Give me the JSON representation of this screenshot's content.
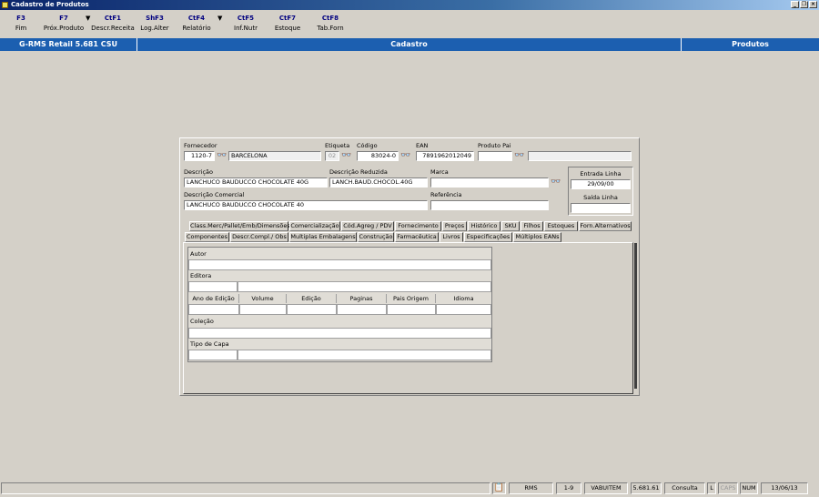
{
  "window": {
    "title": "Cadastro de Produtos",
    "buttons": {
      "minimize": "_",
      "restore": "❐",
      "close": "×"
    }
  },
  "toolbar": [
    {
      "key": "F3",
      "label": "Fim"
    },
    {
      "key": "F7",
      "label": "Próx.Produto"
    },
    {
      "key": "CtF1",
      "label": "Descr.Receita"
    },
    {
      "key": "ShF3",
      "label": "Log.Alter"
    },
    {
      "key": "CtF4",
      "label": "Relatório"
    },
    {
      "key": "CtF5",
      "label": "Inf.Nutr"
    },
    {
      "key": "CtF7",
      "label": "Estoque"
    },
    {
      "key": "CtF8",
      "label": "Tab.Forn"
    }
  ],
  "header": {
    "left": "G-RMS Retail 5.681 CSU",
    "center": "Cadastro",
    "right": "Produtos"
  },
  "form": {
    "fornecedor": {
      "label": "Fornecedor",
      "code": "1120-7",
      "name": "BARCELONA"
    },
    "etiqueta": {
      "label": "Etiqueta",
      "value": "02"
    },
    "codigo": {
      "label": "Código",
      "value": "83024-0"
    },
    "ean": {
      "label": "EAN",
      "value": "7891962012049"
    },
    "produto_pai": {
      "label": "Produto Pai",
      "value": "",
      "desc": ""
    },
    "descricao": {
      "label": "Descrição",
      "value": "LANCHUCO BAUDUCCO CHOCOLATE 40G"
    },
    "descricao_reduzida": {
      "label": "Descrição Reduzida",
      "value": "LANCH.BAUD.CHOCOL.40G"
    },
    "marca": {
      "label": "Marca",
      "value": ""
    },
    "descricao_comercial": {
      "label": "Descrição Comercial",
      "value": "LANCHUCO BAUDUCCO CHOCOLATE 40"
    },
    "referencia": {
      "label": "Referência",
      "value": ""
    },
    "entrada_linha": {
      "label": "Entrada Linha",
      "value": "29/09/00"
    },
    "saida_linha": {
      "label": "Saída Linha",
      "value": ""
    }
  },
  "tabs_row1": [
    "Class.Merc/Pallet/Emb/Dimensões",
    "Comercialização",
    "Cód.Agreg / PDV",
    "Fornecimento",
    "Preços",
    "Histórico",
    "SKU",
    "Filhos",
    "Estoques",
    "Forn.Alternativos"
  ],
  "tabs_row2": [
    "Componentes",
    "Descr.Compl./ Obs",
    "Multiplas Embalagens",
    "Construção",
    "Farmacêutica",
    "Livros",
    "Especificações",
    "Múltiplos EANs"
  ],
  "livros": {
    "autor": "Autor",
    "editora": "Editora",
    "columns": [
      "Ano de Edição",
      "Volume",
      "Edição",
      "Paginas",
      "Pais Origem",
      "Idioma"
    ],
    "colecao": "Coleção",
    "tipo_capa": "Tipo de Capa"
  },
  "status": {
    "items": [
      "RMS",
      "1-9",
      "VABUITEM",
      "5.681.61",
      "Consulta",
      "L",
      "CAPS",
      "NUM",
      "13/06/13"
    ]
  },
  "colors": {
    "accent": "#1c5fb0",
    "title": "#0a246a",
    "background": "#d4d0c8"
  }
}
